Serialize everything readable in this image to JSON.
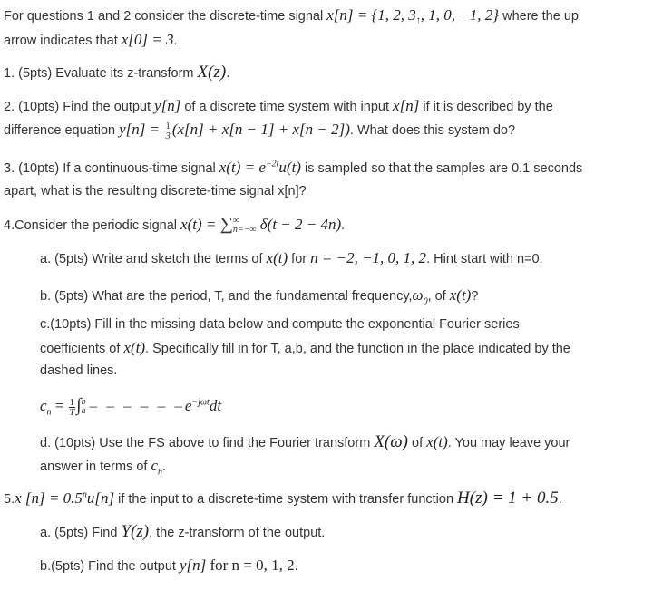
{
  "intro": {
    "text_before": "For questions 1 and 2 consider the discrete-time signal ",
    "signal_lhs": "x[n] = {1, 2, 3",
    "arrow": "↑",
    "signal_rhs": ", 1, 0, −1, 2}",
    "text_mid": " where the up",
    "text_line2": "arrow indicates that ",
    "x0_expr": "x[0] = 3",
    "text_end": "."
  },
  "q1": {
    "text": "1. (5pts) Evaluate its z-transform ",
    "math": "X(z)",
    "end": "."
  },
  "q2": {
    "text1": "2. (10pts) Find the output ",
    "y": "y[n]",
    "text2": " of a discrete time system with input ",
    "x": "x[n]",
    "text3": " if it is described by the",
    "text4": "difference equation ",
    "eq_lhs": "y[n] = ",
    "frac_num": "1",
    "frac_den": "3",
    "eq_rhs": "(x[n] + x[n − 1] + x[n − 2])",
    "text5": ". What does this system do?"
  },
  "q3": {
    "text1": "3. (10pts) If a continuous-time signal ",
    "math_a": "x(t) = e",
    "exp": "−2t",
    "math_b": "u(t)",
    "text2": " is sampled so that the samples are 0.1 seconds",
    "text3": "apart, what is the resulting discrete-time signal x[n]?"
  },
  "q4": {
    "text": "4.Consider the periodic signal ",
    "math_a": "x(t) = ",
    "sum_symbol": "∑",
    "sum_upper": "∞",
    "sum_lower": "n=−∞",
    "math_b": " δ(t − 2 − 4n)",
    "end": ".",
    "a": {
      "text1": "a. (5pts) Write and sketch the terms of ",
      "math1": "x(t)",
      "text2": " for ",
      "math2": "n = −2, −1, 0, 1, 2",
      "text3": ". Hint start with n=0."
    },
    "b": {
      "text1": "b. (5pts) What are the period, T, and the fundamental frequency,",
      "math1": "ω",
      "sub1": "0",
      "text2": ", of ",
      "math2": "x(t)",
      "text3": "?"
    },
    "c": {
      "text1": "c.(10pts) Fill in the  missing data below and compute the exponential Fourier series",
      "text2": "coefficients of ",
      "math1": "x(t)",
      "text3": ". Specifically fill in for T, a,b, and the function in the place indicated by the",
      "text4": "dashed lines.",
      "formula_lhs": "c",
      "formula_lhs_sub": "n",
      "formula_eq": " = ",
      "frac_num": "1",
      "frac_den": "T",
      "integral": "∫",
      "int_upper": "b",
      "int_lower": "a",
      "dashes": "– – – – – –",
      "formula_rhs": "e",
      "formula_exp": "−jωt",
      "formula_dt": "dt"
    },
    "d": {
      "text1": "d. (10pts) Use the FS above to find the Fourier transform ",
      "math1": "X(ω)",
      "text2": " of ",
      "math2": "x(t)",
      "text3": ". You may leave your",
      "text4": "answer in terms of ",
      "math3": "c",
      "math3_sub": "n",
      "end": "."
    }
  },
  "q5": {
    "prefix": "5.",
    "math1": "x [n] = 0.5",
    "exp": "n",
    "math2": "u[n]",
    "text1": " if the input to a discrete-time system with transfer function ",
    "math3": "H(z) = 1 + 0.5",
    "end": ".",
    "a": {
      "text1": "a. (5pts) Find ",
      "math1": "Y(z)",
      "text2": ", the z-transform  of the output."
    },
    "b": {
      "text1": "b.(5pts) Find the output ",
      "math1": "y[n]",
      "math2": " for n = 0, 1, 2",
      "end": "."
    }
  }
}
